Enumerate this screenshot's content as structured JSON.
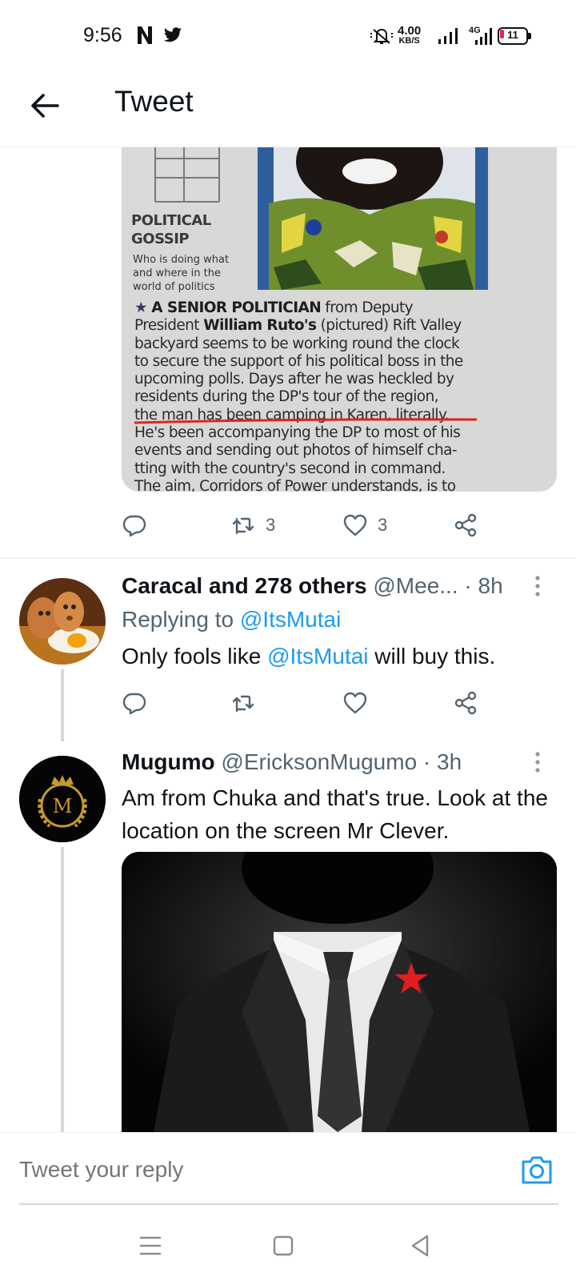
{
  "status_bar": {
    "time": "9:56",
    "net_speed_value": "4.00",
    "net_speed_unit": "KB/S",
    "network_type": "4G",
    "battery_level": "11"
  },
  "header": {
    "title": "Tweet"
  },
  "main_tweet": {
    "image": {
      "caption_title_1": "POLITICAL",
      "caption_title_2": "GOSSIP",
      "caption_sub": "Who is doing what and where in the world of politics",
      "star": "★",
      "lead": "A SENIOR POLITICIAN",
      "line1_rest": " from Deputy",
      "line2_a": "President ",
      "line2_b": "William Ruto's",
      "line2_c": " (pictured) Rift Valley",
      "line3": "backyard seems to be working round the clock",
      "line4": "to secure the support of his political boss in the",
      "line5": "upcoming polls. Days after he was heckled by",
      "line6": "residents during the DP's tour of the region,",
      "line7": "the man has been camping in Karen, literally.",
      "line8": "He's been accompanying the DP to most of his",
      "line9": "events and sending out photos of himself cha-",
      "line10": "tting with the country's second in command.",
      "line11": "The aim, Corridors of Power understands, is to"
    },
    "actions": {
      "retweets": "3",
      "likes": "3"
    }
  },
  "replies": [
    {
      "name": "Caracal and 278 others",
      "handle": "@Mee...",
      "separator": " · ",
      "time": "8h",
      "replying_prefix": "Replying to ",
      "replying_to": "@ItsMutai",
      "text_before": "Only fools like ",
      "text_mention": "@ItsMutai",
      "text_after": " will buy this."
    },
    {
      "name": "Mugumo",
      "handle": "@EricksonMugumo",
      "separator": " · ",
      "time": "3h",
      "text": "Am from Chuka and that's true. Look at the location on the screen Mr Clever.",
      "avatar_letter": "M"
    }
  ],
  "compose": {
    "placeholder": "Tweet your reply"
  },
  "colors": {
    "accent": "#1d9bf0",
    "secondary_text": "#536471",
    "primary_text": "#0f1419"
  }
}
